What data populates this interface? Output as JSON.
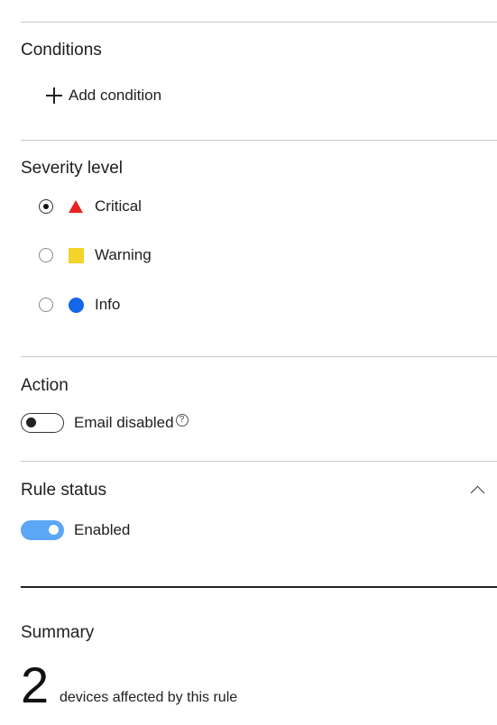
{
  "conditions": {
    "title": "Conditions",
    "add_label": "Add condition"
  },
  "severity": {
    "title": "Severity level",
    "options": [
      {
        "label": "Critical",
        "icon": "triangle-icon",
        "color": "#e8231f",
        "selected": true
      },
      {
        "label": "Warning",
        "icon": "square-icon",
        "color": "#f2d42a",
        "selected": false
      },
      {
        "label": "Info",
        "icon": "circle-icon",
        "color": "#1367e8",
        "selected": false
      }
    ]
  },
  "action": {
    "title": "Action",
    "toggle_label": "Email disabled",
    "toggle_on": false,
    "help_glyph": "?"
  },
  "rule_status": {
    "title": "Rule status",
    "toggle_label": "Enabled",
    "toggle_on": true,
    "toggle_color": "#5ba6f5"
  },
  "summary": {
    "title": "Summary",
    "count": "2",
    "text": "devices affected by this rule"
  }
}
